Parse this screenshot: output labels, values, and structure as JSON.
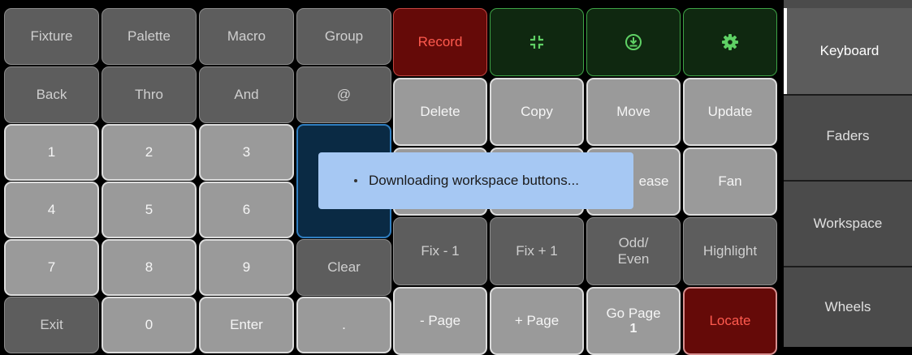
{
  "keypad": {
    "fixture": "Fixture",
    "palette": "Palette",
    "macro": "Macro",
    "group": "Group",
    "back": "Back",
    "thro": "Thro",
    "and": "And",
    "at": "@",
    "d1": "1",
    "d2": "2",
    "d3": "3",
    "d4": "4",
    "d5": "5",
    "d6": "6",
    "d7": "7",
    "d8": "8",
    "d9": "9",
    "clear": "Clear",
    "exit": "Exit",
    "d0": "0",
    "enter": "Enter",
    "dot": "."
  },
  "actions": {
    "record": "Record",
    "icons": [
      "compress-icon",
      "download-circle-icon",
      "gear-icon"
    ],
    "delete": "Delete",
    "copy": "Copy",
    "move": "Move",
    "update": "Update",
    "release_partial": "ease",
    "fan": "Fan",
    "fix_minus": "Fix - 1",
    "fix_plus": "Fix + 1",
    "odd_line1": "Odd/",
    "odd_line2": "Even",
    "highlight": "Highlight",
    "page_minus": "- Page",
    "page_plus": "+ Page",
    "go_page": "Go Page",
    "go_page_number": "1",
    "locate": "Locate"
  },
  "sidebar": {
    "items": [
      {
        "label": "Keyboard",
        "active": true
      },
      {
        "label": "Faders",
        "active": false
      },
      {
        "label": "Workspace",
        "active": false
      },
      {
        "label": "Wheels",
        "active": false
      }
    ]
  },
  "toast": {
    "message": "Downloading workspace buttons..."
  },
  "colors": {
    "record_red": "#650a08",
    "icon_green": "#5fd165",
    "selected_blue": "#0a2a44",
    "toast_blue": "#a6c8f3"
  }
}
